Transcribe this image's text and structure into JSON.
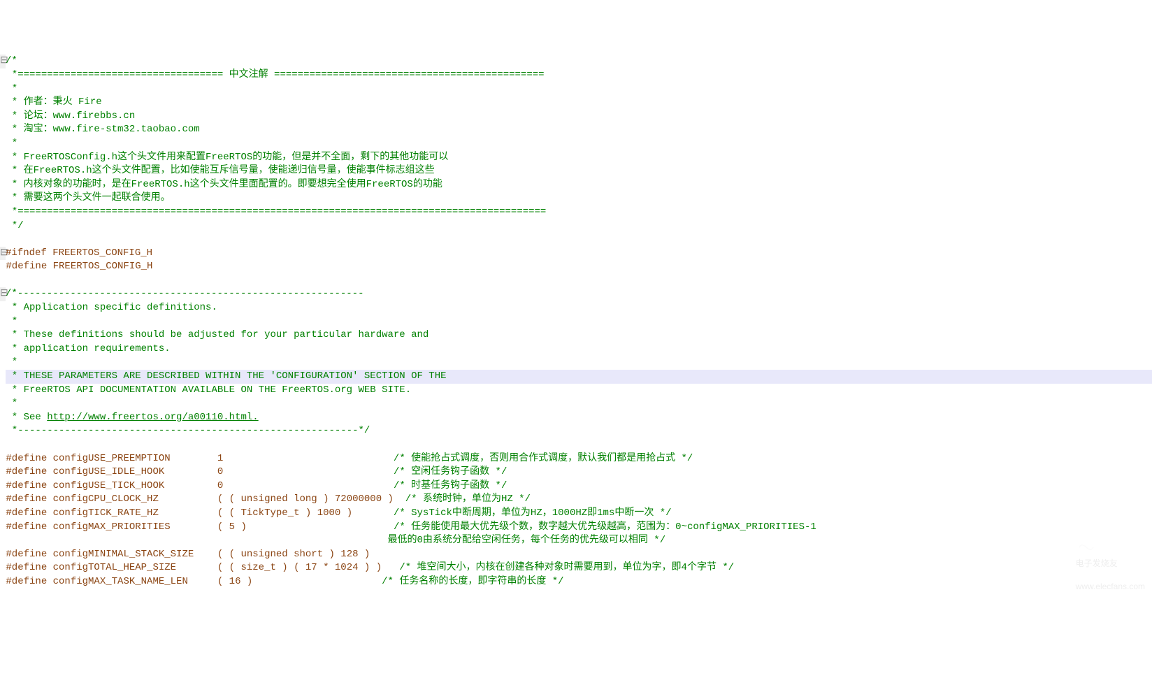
{
  "fold_marker": "⊟",
  "comment_block_top": {
    "l1": "/*",
    "l2": " *=================================== 中文注解 ==============================================",
    "l3": " *",
    "l4": " * 作者：秉火 Fire",
    "l5": " * 论坛：www.firebbs.cn",
    "l6": " * 淘宝：www.fire-stm32.taobao.com",
    "l7": " *",
    "l8": " * FreeRTOSConfig.h这个头文件用来配置FreeRTOS的功能，但是并不全面，剩下的其他功能可以",
    "l9": " * 在FreeRTOS.h这个头文件配置，比如使能互斥信号量，使能递归信号量，使能事件标志组这些",
    "l10": " * 内核对象的功能时，是在FreeRTOS.h这个头文件里面配置的。即要想完全使用FreeRTOS的功能",
    "l11": " * 需要这两个头文件一起联合使用。",
    "l12": " *==========================================================================================",
    "l13": " */"
  },
  "guards": {
    "ifndef": "#ifndef FREERTOS_CONFIG_H",
    "define": "#define FREERTOS_CONFIG_H"
  },
  "comment_block_mid": {
    "l1": "/*-----------------------------------------------------------",
    "l2": " * Application specific definitions.",
    "l3": " *",
    "l4": " * These definitions should be adjusted for your particular hardware and",
    "l5": " * application requirements.",
    "l6": " *",
    "l7": " * THESE PARAMETERS ARE DESCRIBED WITHIN THE 'CONFIGURATION' SECTION OF THE",
    "l8": " * FreeRTOS API DOCUMENTATION AVAILABLE ON THE FreeRTOS.org WEB SITE.",
    "l9": " *",
    "l10_pre": " * See ",
    "l10_link": "http://www.freertos.org/a00110.html.",
    "l11": " *----------------------------------------------------------*/"
  },
  "defines": {
    "d1": {
      "kw": "#define",
      "name": "configUSE_PREEMPTION",
      "val": "1",
      "cmt": "/* 使能抢占式调度，否则用合作式调度，默认我们都是用抢占式 */"
    },
    "d2": {
      "kw": "#define",
      "name": "configUSE_IDLE_HOOK",
      "val": "0",
      "cmt": "/* 空闲任务钩子函数 */"
    },
    "d3": {
      "kw": "#define",
      "name": "configUSE_TICK_HOOK",
      "val": "0",
      "cmt": "/* 时基任务钩子函数 */"
    },
    "d4": {
      "kw": "#define",
      "name": "configCPU_CLOCK_HZ",
      "val": "( ( unsigned long ) 72000000 )",
      "cmt": "/* 系统时钟，单位为HZ */"
    },
    "d5": {
      "kw": "#define",
      "name": "configTICK_RATE_HZ",
      "val": "( ( TickType_t ) 1000 )",
      "cmt": "/* SysTick中断周期，单位为HZ，1000HZ即1ms中断一次 */"
    },
    "d6": {
      "kw": "#define",
      "name": "configMAX_PRIORITIES",
      "val": "( 5 )",
      "cmt": "/* 任务能使用最大优先级个数，数字越大优先级越高，范围为：0~configMAX_PRIORITIES-1"
    },
    "d6b_cmt": "最低的0由系统分配给空闲任务，每个任务的优先级可以相同 */",
    "d7": {
      "kw": "#define",
      "name": "configMINIMAL_STACK_SIZE",
      "val": "( ( unsigned short ) 128 )"
    },
    "d8": {
      "kw": "#define",
      "name": "configTOTAL_HEAP_SIZE",
      "val": "( ( size_t ) ( 17 * 1024 ) )",
      "cmt": "/* 堆空间大小，内核在创建各种对象时需要用到，单位为字，即4个字节 */"
    },
    "d9": {
      "kw": "#define",
      "name": "configMAX_TASK_NAME_LEN",
      "val": "( 16 )",
      "cmt": "/* 任务名称的长度，即字符串的长度 */"
    }
  },
  "watermark": {
    "text": "电子发烧友",
    "url": "www.elecfans.com"
  }
}
